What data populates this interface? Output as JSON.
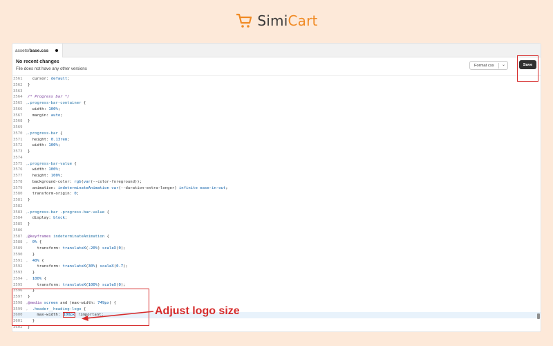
{
  "brand": {
    "name_part1": "Simi",
    "name_part2": "Cart",
    "accent_color": "#f08a24"
  },
  "tab": {
    "path_prefix": "assets/",
    "filename": "base.css"
  },
  "header": {
    "title": "No recent changes",
    "subtitle": "File does not have any other versions"
  },
  "toolbar": {
    "format_label": "Format css",
    "save_label": "Save"
  },
  "annotation": {
    "text": "Adjust logo size",
    "color": "#d62b2b"
  },
  "code_lines": [
    {
      "n": "3561",
      "fold": false,
      "html": "  <span class='k-prop'>cursor</span>: <span class='k-val'>default</span>;"
    },
    {
      "n": "3562",
      "fold": false,
      "html": "}"
    },
    {
      "n": "3563",
      "fold": false,
      "html": ""
    },
    {
      "n": "3564",
      "fold": false,
      "html": "<span class='k-com'>/* Progress bar */</span>"
    },
    {
      "n": "3565",
      "fold": true,
      "html": "<span class='k-sel'>.progress-bar-container</span> {"
    },
    {
      "n": "3566",
      "fold": false,
      "html": "  <span class='k-prop'>width</span>: <span class='k-num'>100%</span>;"
    },
    {
      "n": "3567",
      "fold": false,
      "html": "  <span class='k-prop'>margin</span>: <span class='k-val'>auto</span>;"
    },
    {
      "n": "3568",
      "fold": false,
      "html": "}"
    },
    {
      "n": "3569",
      "fold": false,
      "html": ""
    },
    {
      "n": "3570",
      "fold": true,
      "html": "<span class='k-sel'>.progress-bar</span> {"
    },
    {
      "n": "3571",
      "fold": false,
      "html": "  <span class='k-prop'>height</span>: <span class='k-num'>0.13rem</span>;"
    },
    {
      "n": "3572",
      "fold": false,
      "html": "  <span class='k-prop'>width</span>: <span class='k-num'>100%</span>;"
    },
    {
      "n": "3573",
      "fold": false,
      "html": "}"
    },
    {
      "n": "3574",
      "fold": false,
      "html": ""
    },
    {
      "n": "3575",
      "fold": true,
      "html": "<span class='k-sel'>.progress-bar-value</span> {"
    },
    {
      "n": "3576",
      "fold": false,
      "html": "  <span class='k-prop'>width</span>: <span class='k-num'>100%</span>;"
    },
    {
      "n": "3577",
      "fold": false,
      "html": "  <span class='k-prop'>height</span>: <span class='k-num'>100%</span>;"
    },
    {
      "n": "3578",
      "fold": false,
      "html": "  <span class='k-prop'>background-color</span>: <span class='k-val'>rgb</span>(<span class='k-val'>var</span>(--color-foreground));"
    },
    {
      "n": "3579",
      "fold": false,
      "html": "  <span class='k-prop'>animation</span>: <span class='k-val'>indeterminateAnimation var</span>(--duration-extra-longer) <span class='k-val'>infinite ease-in-out</span>;"
    },
    {
      "n": "3580",
      "fold": false,
      "html": "  <span class='k-prop'>transform-origin</span>: <span class='k-num'>0</span>;"
    },
    {
      "n": "3581",
      "fold": false,
      "html": "}"
    },
    {
      "n": "3582",
      "fold": false,
      "html": ""
    },
    {
      "n": "3583",
      "fold": true,
      "html": "<span class='k-sel'>.progress-bar .progress-bar-value</span> {"
    },
    {
      "n": "3584",
      "fold": false,
      "html": "  <span class='k-prop'>display</span>: <span class='k-val'>block</span>;"
    },
    {
      "n": "3585",
      "fold": false,
      "html": "}"
    },
    {
      "n": "3586",
      "fold": false,
      "html": ""
    },
    {
      "n": "3587",
      "fold": true,
      "html": "<span class='k-at'>@keyframes</span> <span class='k-sel'>indeterminateAnimation</span> {"
    },
    {
      "n": "3588",
      "fold": true,
      "html": "  <span class='k-num'>0%</span> {"
    },
    {
      "n": "3589",
      "fold": false,
      "html": "    <span class='k-prop'>transform</span>: <span class='k-val'>translateX</span>(<span class='k-num'>-20%</span>) <span class='k-val'>scaleX</span>(<span class='k-num'>0</span>);"
    },
    {
      "n": "3590",
      "fold": false,
      "html": "  }"
    },
    {
      "n": "3591",
      "fold": true,
      "html": "  <span class='k-num'>40%</span> {"
    },
    {
      "n": "3592",
      "fold": false,
      "html": "    <span class='k-prop'>transform</span>: <span class='k-val'>translateX</span>(<span class='k-num'>30%</span>) <span class='k-val'>scaleX</span>(<span class='k-num'>0.7</span>);"
    },
    {
      "n": "3593",
      "fold": false,
      "html": "  }"
    },
    {
      "n": "3594",
      "fold": true,
      "html": "  <span class='k-num'>100%</span> {"
    },
    {
      "n": "3595",
      "fold": false,
      "html": "    <span class='k-prop'>transform</span>: <span class='k-val'>translateX</span>(<span class='k-num'>100%</span>) <span class='k-val'>scaleX</span>(<span class='k-num'>0</span>);"
    },
    {
      "n": "3596",
      "fold": false,
      "html": "  }"
    },
    {
      "n": "3597",
      "fold": false,
      "html": "}"
    },
    {
      "n": "3598",
      "fold": true,
      "html": "<span class='k-at'>@media</span> <span class='k-val'>screen</span> and (<span class='k-prop'>max-width</span>: <span class='k-num'>749px</span>) {"
    },
    {
      "n": "3599",
      "fold": true,
      "html": "  <span class='k-sel'>.header__heading-logo</span> {"
    },
    {
      "n": "3600",
      "fold": false,
      "hl": true,
      "html": "    <span class='k-prop'>max-width</span>: <span class='cursor-box'><span class='k-num'>100px</span></span> !important;"
    },
    {
      "n": "3601",
      "fold": false,
      "html": "  }"
    },
    {
      "n": "3602",
      "fold": false,
      "html": "}"
    }
  ]
}
